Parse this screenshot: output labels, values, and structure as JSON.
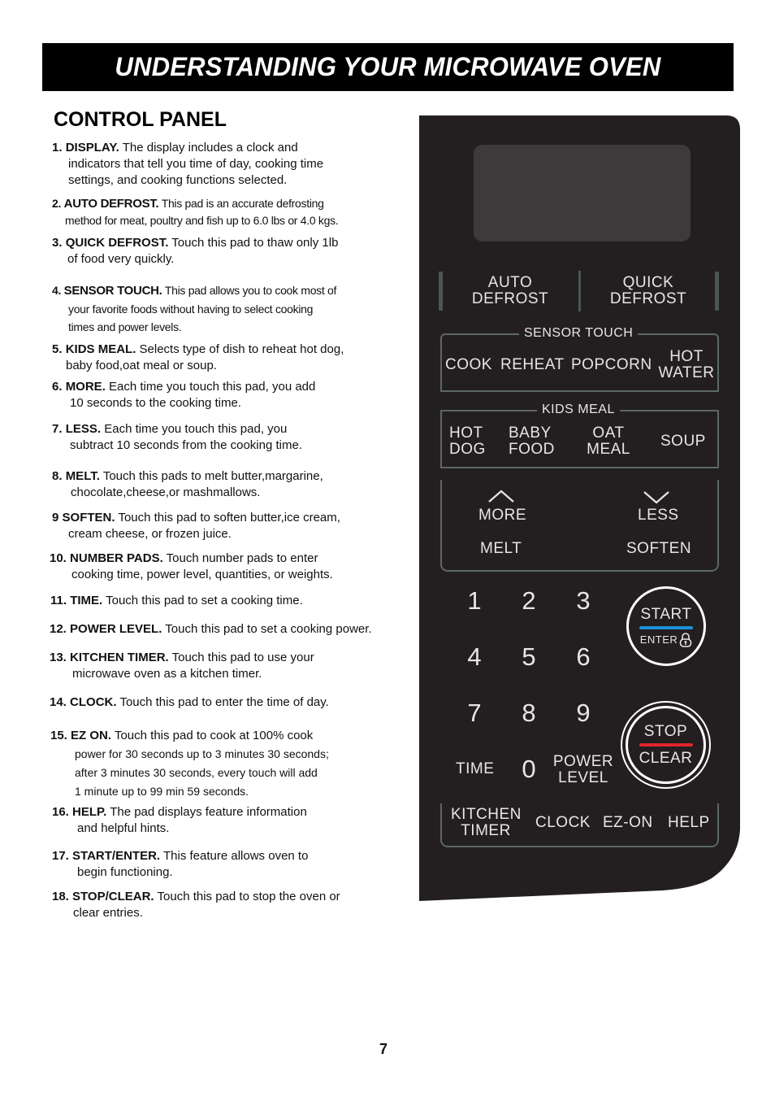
{
  "header": {
    "title": "UNDERSTANDING YOUR MICROWAVE OVEN"
  },
  "section": {
    "title": "CONTROL PANEL"
  },
  "items": [
    {
      "num": "1.",
      "term": "DISPLAY.",
      "lines": [
        "The display includes a clock and",
        "indicators that tell you time of day, cooking time",
        "settings, and cooking functions selected."
      ]
    },
    {
      "num": "2.",
      "term": "AUTO DEFROST.",
      "lines": [
        "This pad is an accurate defrosting",
        "method for meat, poultry and fish up to 6.0 lbs or 4.0 kgs."
      ]
    },
    {
      "num": "3.",
      "term": "QUICK DEFROST.",
      "lines": [
        "Touch this pad to thaw only 1lb",
        "of food very quickly."
      ]
    },
    {
      "num": "4.",
      "term": "SENSOR TOUCH.",
      "lines": [
        "This pad allows you to cook most of",
        "your favorite foods without having to select cooking",
        "times and power levels."
      ]
    },
    {
      "num": "5.",
      "term": "KIDS MEAL.",
      "lines": [
        "Selects type of dish to  reheat hot dog,",
        "baby food,oat meal or soup."
      ]
    },
    {
      "num": "6.",
      "term": "MORE.",
      "lines": [
        "Each time you touch this pad, you add",
        "10 seconds to the cooking time."
      ]
    },
    {
      "num": "7.",
      "term": "LESS.",
      "lines": [
        "Each time you touch this pad, you",
        "subtract 10 seconds from the cooking time."
      ]
    },
    {
      "num": "8.",
      "term": "MELT.",
      "lines": [
        "Touch this pads to melt butter,margarine,",
        "chocolate,cheese,or mashmallows."
      ]
    },
    {
      "num": "9",
      "term": "SOFTEN.",
      "lines": [
        "Touch this pad to soften butter,ice cream,",
        "cream cheese, or frozen juice."
      ]
    },
    {
      "num": "10.",
      "term": "NUMBER PADS.",
      "lines": [
        "Touch number pads to enter",
        "cooking time, power level, quantities, or weights."
      ]
    },
    {
      "num": "11.",
      "term": "TIME.",
      "lines": [
        "Touch this pad to set a cooking time."
      ]
    },
    {
      "num": "12.",
      "term": "POWER LEVEL.",
      "lines": [
        "Touch this pad to set a cooking power."
      ]
    },
    {
      "num": "13.",
      "term": "KITCHEN TIMER.",
      "lines": [
        "Touch this pad to use your",
        "microwave oven as a kitchen timer."
      ]
    },
    {
      "num": "14.",
      "term": "CLOCK.",
      "lines": [
        "Touch this pad to enter the time of day."
      ]
    },
    {
      "num": "15.",
      "term": "EZ ON.",
      "lines": [
        "Touch this pad to cook at 100% cook",
        "power for 30 seconds up to 3 minutes 30 seconds;",
        "after 3 minutes 30 seconds, every touch will add",
        "1 minute up to 99 min 59 seconds."
      ]
    },
    {
      "num": "16.",
      "term": "HELP.",
      "lines": [
        "The pad displays feature information",
        "and helpful hints."
      ]
    },
    {
      "num": "17.",
      "term": "START/ENTER.",
      "lines": [
        "This feature allows oven to",
        "begin functioning."
      ]
    },
    {
      "num": "18.",
      "term": "STOP/CLEAR.",
      "lines": [
        "Touch this pad to stop the oven or",
        "clear entries."
      ]
    }
  ],
  "panel": {
    "defrost": {
      "auto": [
        "AUTO",
        "DEFROST"
      ],
      "quick": [
        "QUICK",
        "DEFROST"
      ]
    },
    "sensor_touch": {
      "label": "SENSOR TOUCH",
      "cook": "COOK",
      "reheat": "REHEAT",
      "popcorn": "POPCORN",
      "hot_water": [
        "HOT",
        "WATER"
      ]
    },
    "kids_meal": {
      "label": "KIDS MEAL",
      "hot_dog": [
        "HOT",
        "DOG"
      ],
      "baby_food": [
        "BABY",
        "FOOD"
      ],
      "oat_meal": [
        "OAT",
        "MEAL"
      ],
      "soup": "SOUP"
    },
    "more": "MORE",
    "less": "LESS",
    "melt": "MELT",
    "soften": "SOFTEN",
    "digits": [
      "1",
      "2",
      "3",
      "4",
      "5",
      "6",
      "7",
      "8",
      "9",
      "0"
    ],
    "time": "TIME",
    "power_level": [
      "POWER",
      "LEVEL"
    ],
    "start": {
      "top": "START",
      "bottom": "ENTER",
      "accent": "#1e8fd6"
    },
    "stop": {
      "top": "STOP",
      "bottom": "CLEAR",
      "accent": "#e0262b"
    },
    "kitchen_timer": [
      "KITCHEN",
      "TIMER"
    ],
    "clock": "CLOCK",
    "ez_on": "EZ-ON",
    "help": "HELP"
  },
  "footer": {
    "page_number": "7"
  }
}
